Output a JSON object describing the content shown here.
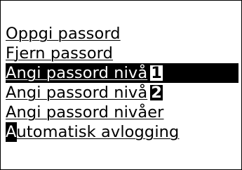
{
  "menu": {
    "items": [
      {
        "label": "Oppgi passord"
      },
      {
        "label": "Fjern passord"
      },
      {
        "label": "Angi passord nivå",
        "level": "1",
        "selected": true
      },
      {
        "label": "Angi passord nivå",
        "level": "2"
      },
      {
        "label": "Angi passord nivåer"
      },
      {
        "cursor_letter": "A",
        "label_rest": "utomatisk avlogging"
      }
    ]
  },
  "colors": {
    "background": "#ffffff",
    "foreground": "#000000",
    "highlight": "#000000"
  }
}
